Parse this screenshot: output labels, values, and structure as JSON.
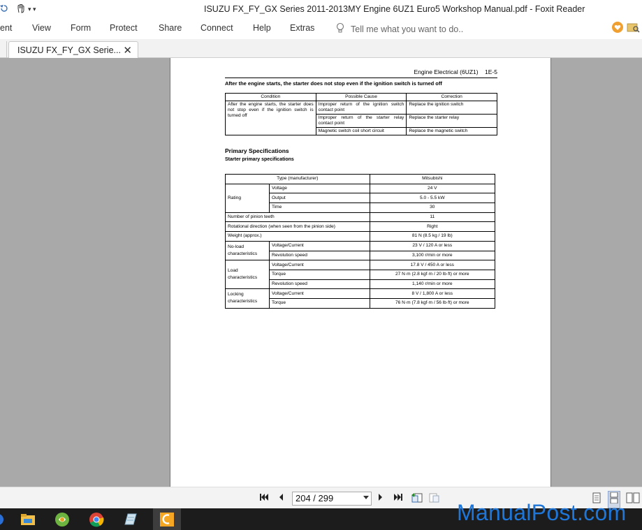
{
  "window": {
    "title": "ISUZU FX_FY_GX Series 2011-2013MY Engine 6UZ1 Euro5 Workshop Manual.pdf - Foxit Reader"
  },
  "menu": {
    "items": [
      "ent",
      "View",
      "Form",
      "Protect",
      "Share",
      "Connect",
      "Help",
      "Extras"
    ],
    "tell_me_placeholder": "Tell me what you want to do.."
  },
  "tabs": [
    {
      "label": "ISUZU FX_FY_GX Serie...",
      "close": "✕"
    }
  ],
  "document": {
    "header": "Engine Electrical (6UZ1)    1E-5",
    "trouble_heading": "After the engine starts, the starter does not stop even if the ignition switch is turned off",
    "trouble_table": {
      "headers": [
        "Condition",
        "Possible Cause",
        "Correction"
      ],
      "condition": "After the engine starts, the starter does not stop even if the ignition switch is turned off",
      "rows": [
        {
          "cause": "Improper return of the ignition switch contact point",
          "correction": "Replace the ignition switch"
        },
        {
          "cause": "Improper return of the starter relay contact point",
          "correction": "Replace the starter relay"
        },
        {
          "cause": "Magnetic switch coil short circuit",
          "correction": "Replace the magnetic switch"
        }
      ]
    },
    "section_title": "Primary Specifications",
    "sub_title": "Starter primary specifications",
    "specs": {
      "type_label": "Type (manufacturer)",
      "type_value": "Mitsubishi",
      "rating_label": "Rating",
      "voltage_label": "Voltage",
      "voltage_value": "24 V",
      "output_label": "Output",
      "output_value": "5.0 - 5.5 kW",
      "time_label": "Time",
      "time_value": "30",
      "pinion_label": "Number of pinion teeth",
      "pinion_value": "11",
      "rotation_label": "Rotational direction (when seen from the pinion side)",
      "rotation_value": "Right",
      "weight_label": "Weight (approx.)",
      "weight_value": "81 N (8.5 kg / 19 lb)",
      "noload_label": "No-load characteristics",
      "noload_vc_label": "Voltage/Current",
      "noload_vc_value": "23 V / 120 A or less",
      "noload_rev_label": "Revolution speed",
      "noload_rev_value": "3,100 r/min or more",
      "load_label": "Load characteristics",
      "load_vc_label": "Voltage/Current",
      "load_vc_value": "17.8 V / 450 A or less",
      "load_torque_label": "Torque",
      "load_torque_value": "27 N·m (2.8 kgf·m / 20 lb·ft) or more",
      "load_rev_label": "Revolution speed",
      "load_rev_value": "1,140 r/min or more",
      "locking_label": "Locking characteristics",
      "locking_vc_label": "Voltage/Current",
      "locking_vc_value": "8 V / 1,800 A or less",
      "locking_torque_label": "Torque",
      "locking_torque_value": "76 N·m (7.8 kgf·m / 56 lb·ft) or more"
    }
  },
  "navigation": {
    "page_indicator": "204 / 299"
  },
  "watermark": "ManualPost.com",
  "icons": [
    "undo-icon",
    "hand-tool-icon",
    "customize-qa-icon",
    "lightbulb-icon",
    "heart-icon",
    "find-folder-icon",
    "first-page-icon",
    "prev-page-icon",
    "next-page-icon",
    "last-page-icon",
    "prev-view-icon",
    "next-view-icon",
    "single-page-icon",
    "continuous-page-icon",
    "facing-page-icon",
    "start-icon",
    "file-explorer-icon",
    "app-icon",
    "chrome-icon",
    "notepad-icon",
    "foxit-icon"
  ],
  "colors": {
    "doc_background": "#a9a9a9",
    "taskbar": "#1c1c1c",
    "watermark": "#1e77d8",
    "foxit_orange": "#f5a623"
  }
}
